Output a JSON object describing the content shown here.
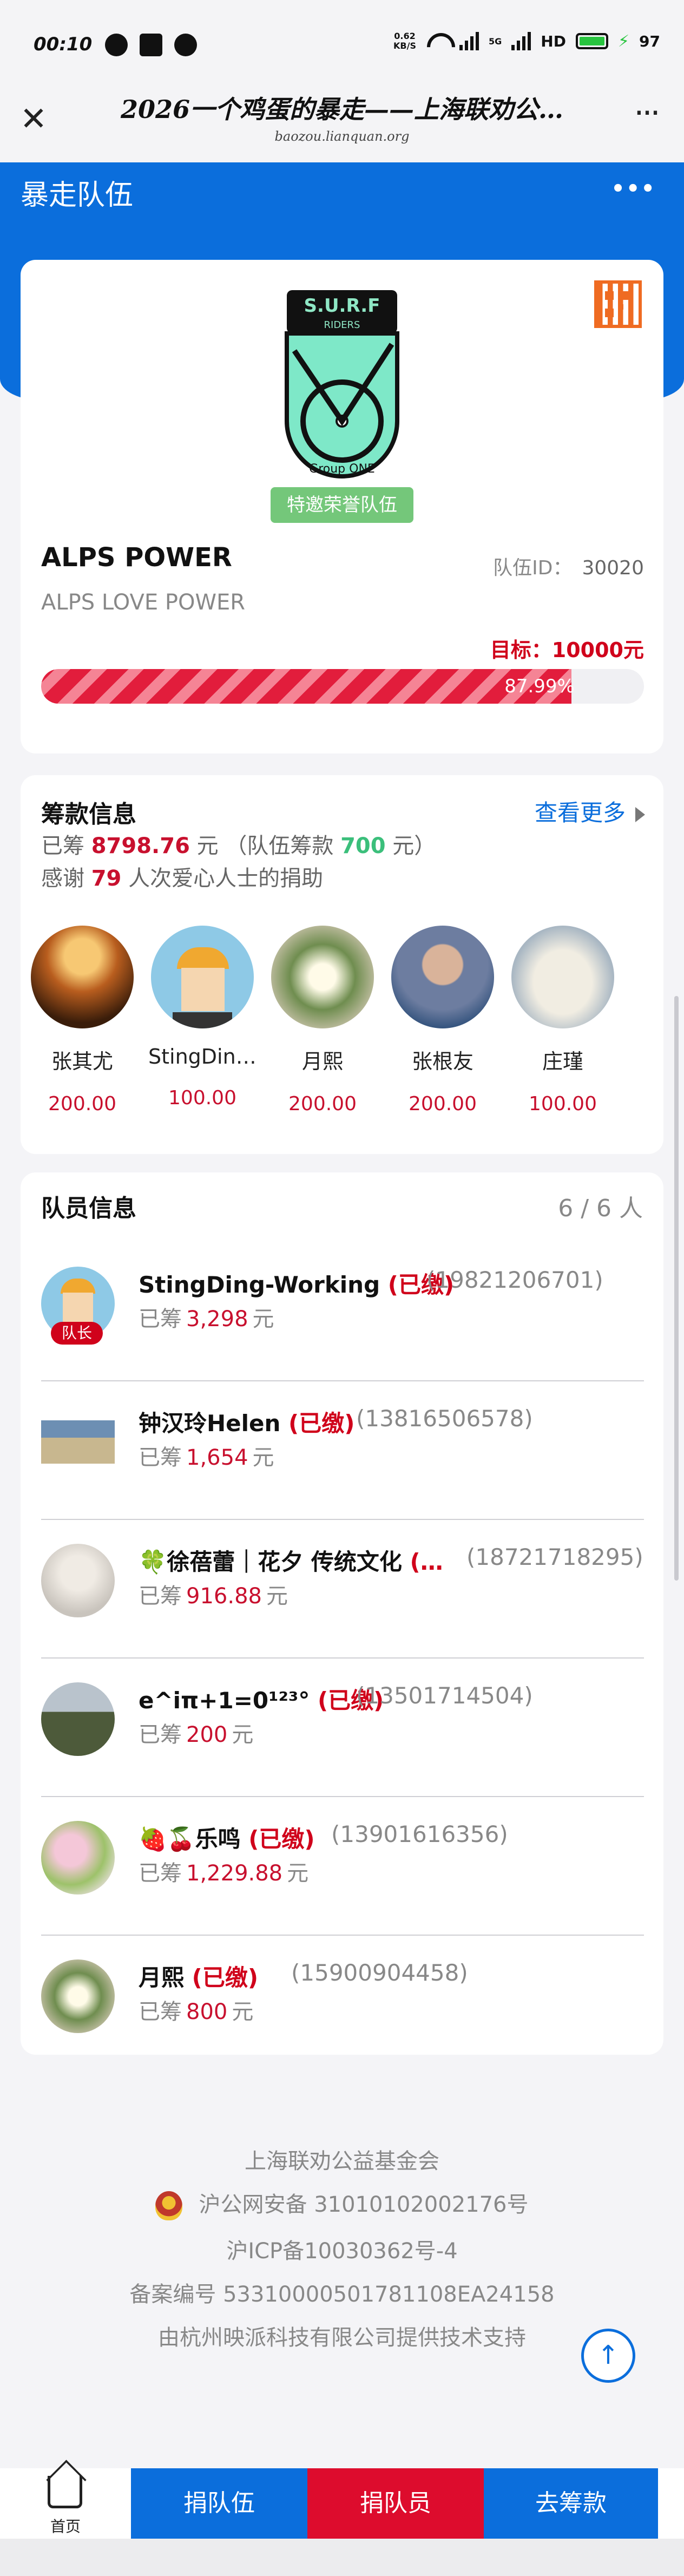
{
  "status_bar": {
    "time": "00:10",
    "net_speed_value": "0.62",
    "net_speed_unit": "KB/S",
    "network_tags": [
      "5G",
      "5G",
      "HD"
    ],
    "battery_level": "97"
  },
  "browser": {
    "title": "2026一个鸡蛋的暴走——上海联劝公…",
    "domain": "baozou.lianquan.org"
  },
  "header": {
    "title": "暴走队伍"
  },
  "team": {
    "logo_top_text": "S.U.R.F",
    "logo_sub_text": "RIDERS",
    "logo_bottom_text": "Group ONE",
    "honor_badge": "特邀荣誉队伍",
    "name": "ALPS POWER",
    "id_label": "队伍ID：",
    "id_value": "30020",
    "slogan": "ALPS LOVE POWER",
    "target_text": "目标：10000元",
    "progress_percent": 87.99,
    "progress_label": "87.99%",
    "colors": {
      "brand_blue": "#0b6edc",
      "accent_red": "#d0021b",
      "honor_green": "#74c77a"
    }
  },
  "fund": {
    "title": "筹款信息",
    "more_label": "查看更多",
    "raised_prefix": "已筹",
    "raised_amount": "8798.76",
    "raised_unit": "元",
    "team_fund_prefix": "（队伍筹款",
    "team_fund_amount": "700",
    "team_fund_suffix": "元）",
    "thanks_prefix": "感谢",
    "donor_count": "79",
    "thanks_suffix": "人次爱心人士的捐助",
    "donors": [
      {
        "name": "张其尤",
        "amount": "200.00",
        "avatar": "pagoda-photo"
      },
      {
        "name": "StingDing-…",
        "amount": "100.00",
        "avatar": "cartoon-avatar"
      },
      {
        "name": "月熙",
        "amount": "200.00",
        "avatar": "flower-photo"
      },
      {
        "name": "张根友",
        "amount": "200.00",
        "avatar": "person-photo"
      },
      {
        "name": "庄瑾",
        "amount": "100.00",
        "avatar": "polar-bear-photo"
      }
    ]
  },
  "members": {
    "title": "队员信息",
    "count": "6 / 6 人",
    "leader_badge": "队长",
    "raised_prefix": "已筹",
    "raised_unit": "元",
    "list": [
      {
        "name": "StingDing-Working",
        "paid": "(已缴)",
        "phone": "(19821206701)",
        "raised": "3,298",
        "leader": true,
        "avatar": "cartoon-avatar"
      },
      {
        "name": "钟汉玲Helen",
        "paid": "(已缴)",
        "phone": "(13816506578)",
        "raised": "1,654",
        "leader": false,
        "avatar": "runner-photo"
      },
      {
        "name": "🍀徐蓓蕾｜花夕 传统文化",
        "paid": "(…",
        "phone": "(18721718295)",
        "raised": "916.88",
        "leader": false,
        "avatar": "woman-photo"
      },
      {
        "name": "e^iπ+1=0¹²³°",
        "paid": "(已缴)",
        "phone": "(13501714504)",
        "raised": "200",
        "leader": false,
        "avatar": "hiker-photo"
      },
      {
        "name": "🍓🍒乐鸣",
        "paid": "(已缴)",
        "phone": "(13901616356)",
        "raised": "1,229.88",
        "leader": false,
        "avatar": "girl-flowers-photo"
      },
      {
        "name": "月熙",
        "paid": "(已缴)",
        "phone": "(15900904458)",
        "raised": "800",
        "leader": false,
        "avatar": "flower-photo"
      }
    ]
  },
  "footer": {
    "org": "上海联劝公益基金会",
    "police_record": "沪公网安备  31010102002176号",
    "icp": "沪ICP备10030362号-4",
    "filing": "备案编号 53310000501781108EA24158",
    "support": "由杭州映派科技有限公司提供技术支持"
  },
  "bottom_nav": {
    "home_label": "首页",
    "donate_team": "捐队伍",
    "donate_member": "捐队员",
    "go_raise": "去筹款"
  }
}
